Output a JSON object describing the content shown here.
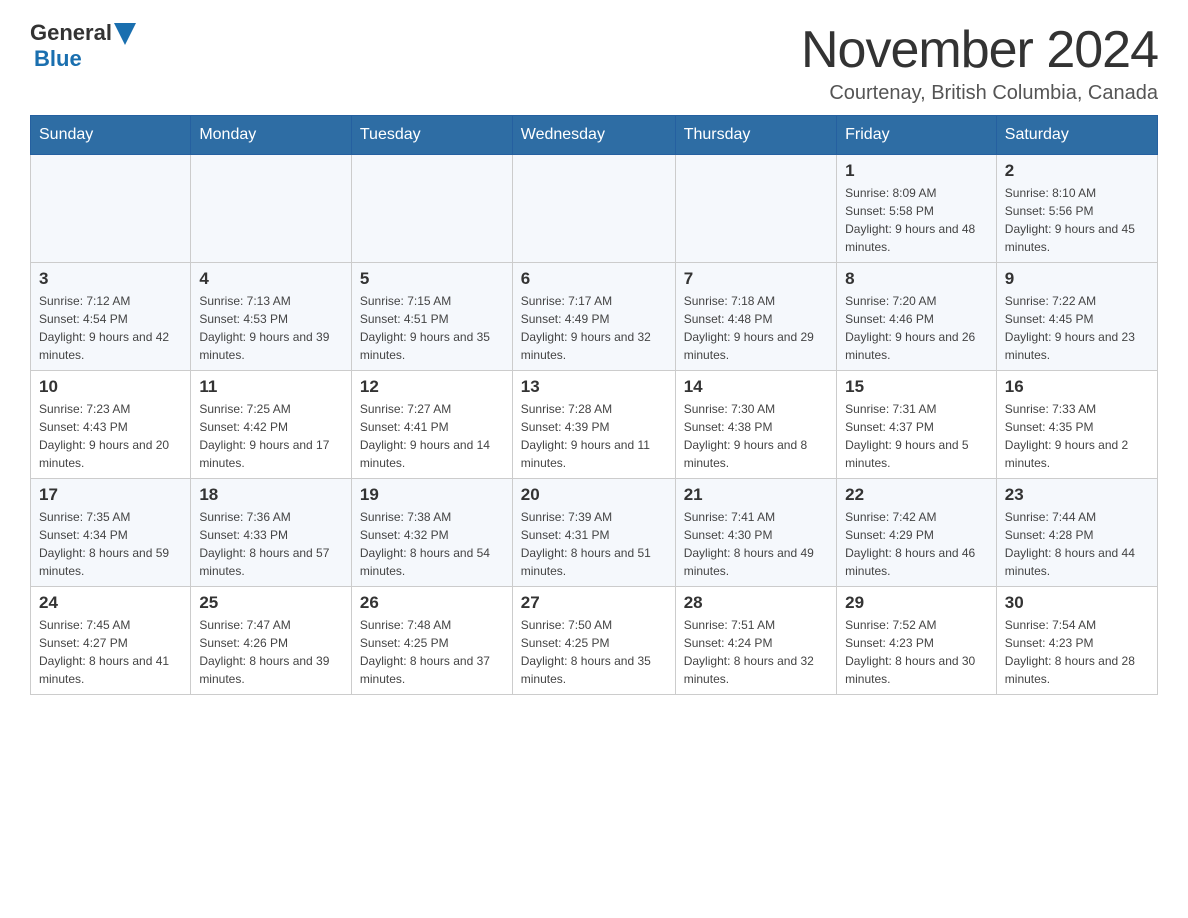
{
  "header": {
    "logo_general": "General",
    "logo_blue": "Blue",
    "month_title": "November 2024",
    "location": "Courtenay, British Columbia, Canada"
  },
  "days_of_week": [
    "Sunday",
    "Monday",
    "Tuesday",
    "Wednesday",
    "Thursday",
    "Friday",
    "Saturday"
  ],
  "weeks": [
    [
      {
        "day": "",
        "sunrise": "",
        "sunset": "",
        "daylight": ""
      },
      {
        "day": "",
        "sunrise": "",
        "sunset": "",
        "daylight": ""
      },
      {
        "day": "",
        "sunrise": "",
        "sunset": "",
        "daylight": ""
      },
      {
        "day": "",
        "sunrise": "",
        "sunset": "",
        "daylight": ""
      },
      {
        "day": "",
        "sunrise": "",
        "sunset": "",
        "daylight": ""
      },
      {
        "day": "1",
        "sunrise": "Sunrise: 8:09 AM",
        "sunset": "Sunset: 5:58 PM",
        "daylight": "Daylight: 9 hours and 48 minutes."
      },
      {
        "day": "2",
        "sunrise": "Sunrise: 8:10 AM",
        "sunset": "Sunset: 5:56 PM",
        "daylight": "Daylight: 9 hours and 45 minutes."
      }
    ],
    [
      {
        "day": "3",
        "sunrise": "Sunrise: 7:12 AM",
        "sunset": "Sunset: 4:54 PM",
        "daylight": "Daylight: 9 hours and 42 minutes."
      },
      {
        "day": "4",
        "sunrise": "Sunrise: 7:13 AM",
        "sunset": "Sunset: 4:53 PM",
        "daylight": "Daylight: 9 hours and 39 minutes."
      },
      {
        "day": "5",
        "sunrise": "Sunrise: 7:15 AM",
        "sunset": "Sunset: 4:51 PM",
        "daylight": "Daylight: 9 hours and 35 minutes."
      },
      {
        "day": "6",
        "sunrise": "Sunrise: 7:17 AM",
        "sunset": "Sunset: 4:49 PM",
        "daylight": "Daylight: 9 hours and 32 minutes."
      },
      {
        "day": "7",
        "sunrise": "Sunrise: 7:18 AM",
        "sunset": "Sunset: 4:48 PM",
        "daylight": "Daylight: 9 hours and 29 minutes."
      },
      {
        "day": "8",
        "sunrise": "Sunrise: 7:20 AM",
        "sunset": "Sunset: 4:46 PM",
        "daylight": "Daylight: 9 hours and 26 minutes."
      },
      {
        "day": "9",
        "sunrise": "Sunrise: 7:22 AM",
        "sunset": "Sunset: 4:45 PM",
        "daylight": "Daylight: 9 hours and 23 minutes."
      }
    ],
    [
      {
        "day": "10",
        "sunrise": "Sunrise: 7:23 AM",
        "sunset": "Sunset: 4:43 PM",
        "daylight": "Daylight: 9 hours and 20 minutes."
      },
      {
        "day": "11",
        "sunrise": "Sunrise: 7:25 AM",
        "sunset": "Sunset: 4:42 PM",
        "daylight": "Daylight: 9 hours and 17 minutes."
      },
      {
        "day": "12",
        "sunrise": "Sunrise: 7:27 AM",
        "sunset": "Sunset: 4:41 PM",
        "daylight": "Daylight: 9 hours and 14 minutes."
      },
      {
        "day": "13",
        "sunrise": "Sunrise: 7:28 AM",
        "sunset": "Sunset: 4:39 PM",
        "daylight": "Daylight: 9 hours and 11 minutes."
      },
      {
        "day": "14",
        "sunrise": "Sunrise: 7:30 AM",
        "sunset": "Sunset: 4:38 PM",
        "daylight": "Daylight: 9 hours and 8 minutes."
      },
      {
        "day": "15",
        "sunrise": "Sunrise: 7:31 AM",
        "sunset": "Sunset: 4:37 PM",
        "daylight": "Daylight: 9 hours and 5 minutes."
      },
      {
        "day": "16",
        "sunrise": "Sunrise: 7:33 AM",
        "sunset": "Sunset: 4:35 PM",
        "daylight": "Daylight: 9 hours and 2 minutes."
      }
    ],
    [
      {
        "day": "17",
        "sunrise": "Sunrise: 7:35 AM",
        "sunset": "Sunset: 4:34 PM",
        "daylight": "Daylight: 8 hours and 59 minutes."
      },
      {
        "day": "18",
        "sunrise": "Sunrise: 7:36 AM",
        "sunset": "Sunset: 4:33 PM",
        "daylight": "Daylight: 8 hours and 57 minutes."
      },
      {
        "day": "19",
        "sunrise": "Sunrise: 7:38 AM",
        "sunset": "Sunset: 4:32 PM",
        "daylight": "Daylight: 8 hours and 54 minutes."
      },
      {
        "day": "20",
        "sunrise": "Sunrise: 7:39 AM",
        "sunset": "Sunset: 4:31 PM",
        "daylight": "Daylight: 8 hours and 51 minutes."
      },
      {
        "day": "21",
        "sunrise": "Sunrise: 7:41 AM",
        "sunset": "Sunset: 4:30 PM",
        "daylight": "Daylight: 8 hours and 49 minutes."
      },
      {
        "day": "22",
        "sunrise": "Sunrise: 7:42 AM",
        "sunset": "Sunset: 4:29 PM",
        "daylight": "Daylight: 8 hours and 46 minutes."
      },
      {
        "day": "23",
        "sunrise": "Sunrise: 7:44 AM",
        "sunset": "Sunset: 4:28 PM",
        "daylight": "Daylight: 8 hours and 44 minutes."
      }
    ],
    [
      {
        "day": "24",
        "sunrise": "Sunrise: 7:45 AM",
        "sunset": "Sunset: 4:27 PM",
        "daylight": "Daylight: 8 hours and 41 minutes."
      },
      {
        "day": "25",
        "sunrise": "Sunrise: 7:47 AM",
        "sunset": "Sunset: 4:26 PM",
        "daylight": "Daylight: 8 hours and 39 minutes."
      },
      {
        "day": "26",
        "sunrise": "Sunrise: 7:48 AM",
        "sunset": "Sunset: 4:25 PM",
        "daylight": "Daylight: 8 hours and 37 minutes."
      },
      {
        "day": "27",
        "sunrise": "Sunrise: 7:50 AM",
        "sunset": "Sunset: 4:25 PM",
        "daylight": "Daylight: 8 hours and 35 minutes."
      },
      {
        "day": "28",
        "sunrise": "Sunrise: 7:51 AM",
        "sunset": "Sunset: 4:24 PM",
        "daylight": "Daylight: 8 hours and 32 minutes."
      },
      {
        "day": "29",
        "sunrise": "Sunrise: 7:52 AM",
        "sunset": "Sunset: 4:23 PM",
        "daylight": "Daylight: 8 hours and 30 minutes."
      },
      {
        "day": "30",
        "sunrise": "Sunrise: 7:54 AM",
        "sunset": "Sunset: 4:23 PM",
        "daylight": "Daylight: 8 hours and 28 minutes."
      }
    ]
  ]
}
